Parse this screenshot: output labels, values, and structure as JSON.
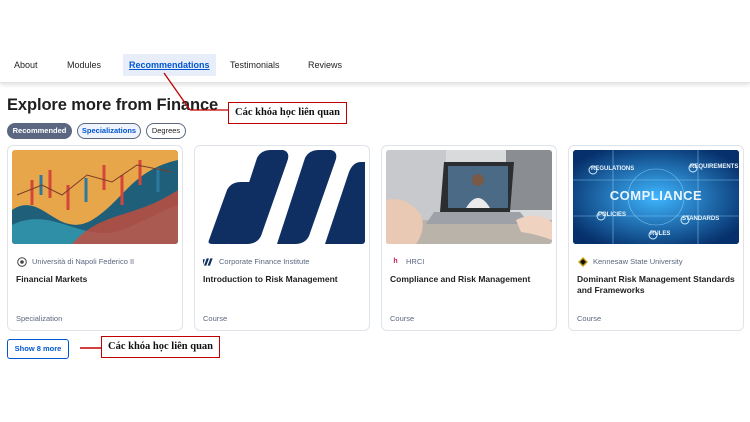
{
  "tabs": [
    {
      "label": "About"
    },
    {
      "label": "Modules"
    },
    {
      "label": "Recommendations"
    },
    {
      "label": "Testimonials"
    },
    {
      "label": "Reviews"
    }
  ],
  "section": {
    "title": "Explore more from Finance"
  },
  "filters": [
    {
      "label": "Recommended"
    },
    {
      "label": "Specializations"
    },
    {
      "label": "Degrees"
    }
  ],
  "cards": [
    {
      "partner": "Università di Napoli Federico II",
      "title": "Financial Markets",
      "type": "Specialization"
    },
    {
      "partner": "Corporate Finance Institute",
      "title": "Introduction to Risk Management",
      "type": "Course"
    },
    {
      "partner": "HRCI",
      "title": "Compliance and Risk Management",
      "type": "Course"
    },
    {
      "partner": "Kennesaw State University",
      "title": "Dominant Risk Management Standards and Frameworks",
      "type": "Course"
    }
  ],
  "compliance_image": {
    "center": "COMPLIANCE",
    "labels": [
      "REGULATIONS",
      "REQUIREMENTS",
      "POLICIES",
      "STANDARDS",
      "RULES"
    ]
  },
  "show_more": {
    "label": "Show 8 more"
  },
  "annotations": [
    {
      "text": "Các khóa học liên quan"
    },
    {
      "text": "Các khóa học liên quan"
    }
  ],
  "colors": {
    "accent": "#0056d2",
    "annotation": "#c00000",
    "chip_active": "#5b6780"
  }
}
